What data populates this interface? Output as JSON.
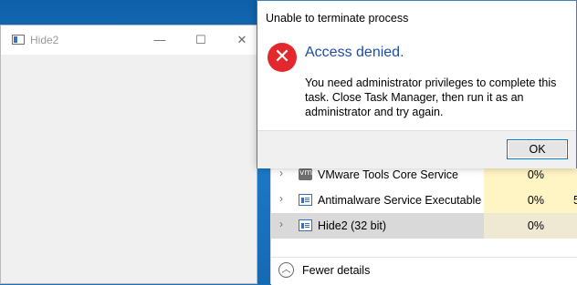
{
  "hide2_window": {
    "title": "Hide2",
    "minimize_glyph": "—",
    "maximize_glyph": "☐",
    "close_glyph": "✕"
  },
  "dialog": {
    "title": "Unable to terminate process",
    "icon": "error-icon",
    "icon_glyph": "✕",
    "main_instruction": "Access denied.",
    "content": "You need administrator privileges to complete this task. Close Task Manager, then run it as an administrator and try again.",
    "ok_label": "OK"
  },
  "task_manager": {
    "rows": [
      {
        "name": "VMware Tools Core Service",
        "cpu": "0%",
        "extra": "",
        "icon": "vmware-icon"
      },
      {
        "name": "Antimalware Service Executable",
        "cpu": "0%",
        "extra": "5",
        "icon": "app-window-icon"
      },
      {
        "name": "Hide2 (32 bit)",
        "cpu": "0%",
        "extra": "",
        "icon": "app-window-icon"
      }
    ],
    "fewer_details_label": "Fewer details"
  },
  "colors": {
    "accent": "#0078d7",
    "error": "#e3282d",
    "main_instruction": "#1f4ea6",
    "cpu_highlight": "#fff4c4"
  }
}
